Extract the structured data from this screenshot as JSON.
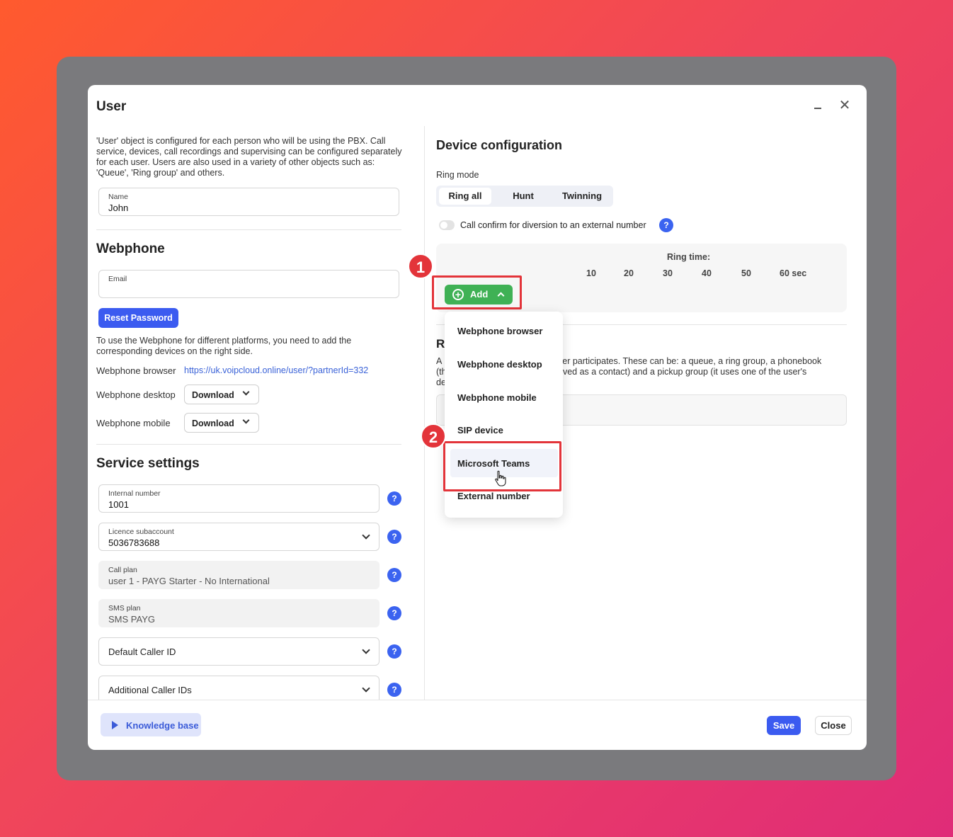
{
  "dialog": {
    "title": "User"
  },
  "left": {
    "description": "'User' object is configured for each person who will be using the PBX. Call service, devices, call recordings and supervising can be configured separately for each user. Users are also used in a variety of other objects such as: 'Queue', 'Ring group' and others.",
    "name_field": {
      "label": "Name",
      "value": "John"
    },
    "webphone": {
      "heading": "Webphone",
      "email_label": "Email",
      "email_value": "",
      "reset_password": "Reset Password",
      "info": "To use the Webphone for different platforms, you need to add the corresponding devices on the right side.",
      "browser_label": "Webphone browser",
      "browser_link": "https://uk.voipcloud.online/user/?partnerId=332",
      "desktop_label": "Webphone desktop",
      "desktop_button": "Download",
      "mobile_label": "Webphone mobile",
      "mobile_button": "Download"
    },
    "service": {
      "heading": "Service settings",
      "internal_number": {
        "label": "Internal number",
        "value": "1001"
      },
      "licence": {
        "label": "Licence subaccount",
        "value": "5036783688"
      },
      "call_plan": {
        "label": "Call plan",
        "value": "user 1 - PAYG Starter - No International"
      },
      "sms_plan": {
        "label": "SMS plan",
        "value": "SMS PAYG"
      },
      "default_caller_id": "Default Caller ID",
      "additional_caller_ids": "Additional Caller IDs",
      "help_glyph": "?"
    }
  },
  "right": {
    "heading": "Device configuration",
    "ring_mode_label": "Ring mode",
    "ring_modes": [
      "Ring all",
      "Hunt",
      "Twinning"
    ],
    "ring_mode_selected": "Ring all",
    "call_confirm_label": "Call confirm for diversion to an external number",
    "call_confirm_enabled": false,
    "ring_time_label": "Ring time:",
    "ring_ticks": [
      "10",
      "20",
      "30",
      "40",
      "50",
      "60 sec"
    ],
    "add_button": "Add",
    "add_plus": "+",
    "partial_heading": "R",
    "partial_text_left": "A\n(th\nde",
    "partial_text_right": "ser participates. These can be: a queue, a ring group, a phonebook\naved as a contact) and a pickup group (it uses one of the user's"
  },
  "dropdown": {
    "items": [
      "Webphone browser",
      "Webphone desktop",
      "Webphone mobile",
      "SIP device",
      "Microsoft Teams",
      "External number"
    ],
    "hovered": "Microsoft Teams"
  },
  "annotations": {
    "step1": "1",
    "step2": "2",
    "color": "#e3343a"
  },
  "footer": {
    "knowledge_base": "Knowledge base",
    "save": "Save",
    "close": "Close"
  },
  "colors": {
    "primary": "#3b5bf0",
    "add_green": "#3fb155",
    "help_blue": "#3b63f0"
  }
}
